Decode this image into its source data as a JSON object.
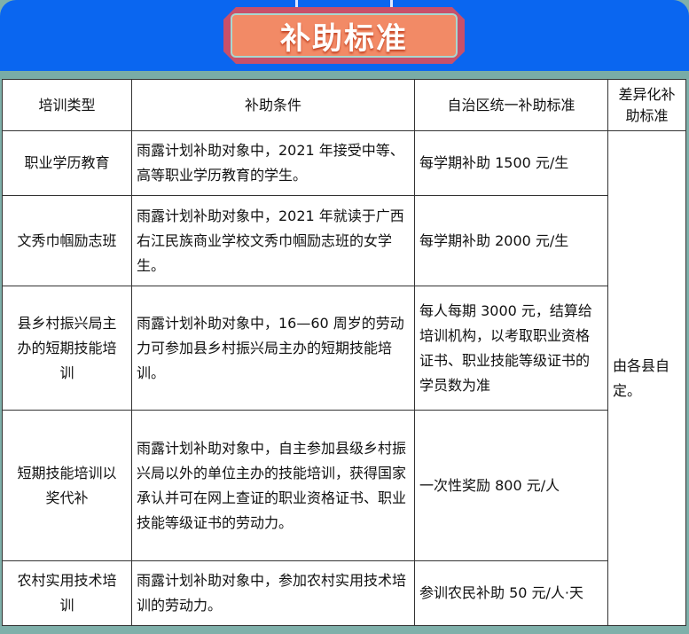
{
  "title": "补助标准",
  "headers": [
    "培训类型",
    "补助条件",
    "自治区统一补助标准",
    "差异化补助标准"
  ],
  "rows": [
    {
      "type": "职业学历教育",
      "condition": "雨露计划补助对象中，2021 年接受中等、高等职业学历教育的学生。",
      "standard": "每学期补助 1500 元/生"
    },
    {
      "type": "文秀巾帼励志班",
      "condition": "雨露计划补助对象中，2021 年就读于广西右江民族商业学校文秀巾帼励志班的女学生。",
      "standard": "每学期补助 2000 元/生"
    },
    {
      "type": "县乡村振兴局主办的短期技能培训",
      "condition": "雨露计划补助对象中，16—60 周岁的劳动力可参加县乡村振兴局主办的短期技能培训。",
      "standard": "每人每期 3000 元，结算给培训机构，以考取职业资格证书、职业技能等级证书的学员数为准"
    },
    {
      "type": "短期技能培训以奖代补",
      "condition": "雨露计划补助对象中，自主参加县级乡村振兴局以外的单位主办的技能培训，获得国家承认并可在网上查证的职业资格证书、职业技能等级证书的劳动力。",
      "standard": "一次性奖励 800 元/人"
    },
    {
      "type": "农村实用技术培训",
      "condition": "雨露计划补助对象中，参加农村实用技术培训的劳动力。",
      "standard": "参训农民补助 50 元/人·天"
    }
  ],
  "differential": "由各县自定。"
}
